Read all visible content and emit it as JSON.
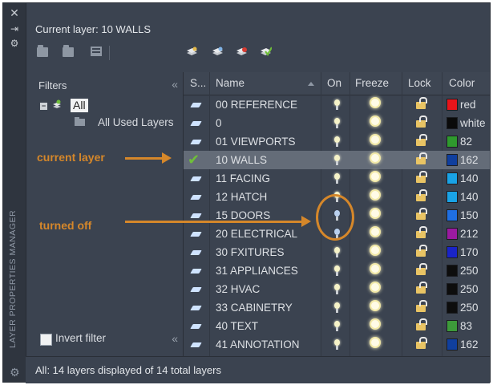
{
  "window": {
    "current_layer_text": "Current layer: 10 WALLS",
    "vertical_title": "LAYER PROPERTIES MANAGER",
    "status_text": "All: 14 layers displayed of 14 total layers"
  },
  "filters": {
    "title": "Filters",
    "tree_root": "All",
    "tree_child": "All Used Layers",
    "invert_label": "Invert filter",
    "collapse_symbol": "«"
  },
  "table": {
    "headers": {
      "status": "S...",
      "name": "Name",
      "on": "On",
      "freeze": "Freeze",
      "lock": "Lock",
      "color": "Color"
    },
    "rows": [
      {
        "name": "00 REFERENCE",
        "on": true,
        "color_name": "red",
        "color_hex": "#e8141b",
        "current": false
      },
      {
        "name": "0",
        "on": true,
        "color_name": "white",
        "color_hex": "#0a0a0a",
        "current": false
      },
      {
        "name": "01 VIEWPORTS",
        "on": true,
        "color_name": "82",
        "color_hex": "#2f9a2e",
        "current": false
      },
      {
        "name": "10 WALLS",
        "on": true,
        "color_name": "162",
        "color_hex": "#103f9e",
        "current": true
      },
      {
        "name": "11 FACING",
        "on": true,
        "color_name": "140",
        "color_hex": "#19a3e6",
        "current": false
      },
      {
        "name": "12 HATCH",
        "on": true,
        "color_name": "140",
        "color_hex": "#19a3e6",
        "current": false
      },
      {
        "name": "15 DOORS",
        "on": false,
        "color_name": "150",
        "color_hex": "#1f6fe3",
        "current": false
      },
      {
        "name": "20 ELECTRICAL",
        "on": false,
        "color_name": "212",
        "color_hex": "#9a1aa0",
        "current": false
      },
      {
        "name": "30 FXITURES",
        "on": true,
        "color_name": "170",
        "color_hex": "#1a24c8",
        "current": false
      },
      {
        "name": "31 APPLIANCES",
        "on": true,
        "color_name": "250",
        "color_hex": "#0d0d0d",
        "current": false
      },
      {
        "name": "32 HVAC",
        "on": true,
        "color_name": "250",
        "color_hex": "#0d0d0d",
        "current": false
      },
      {
        "name": "33 CABINETRY",
        "on": true,
        "color_name": "250",
        "color_hex": "#0d0d0d",
        "current": false
      },
      {
        "name": "40 TEXT",
        "on": true,
        "color_name": "83",
        "color_hex": "#3d9a3a",
        "current": false
      },
      {
        "name": "41 ANNOTATION",
        "on": true,
        "color_name": "162",
        "color_hex": "#103f9e",
        "current": false
      }
    ]
  },
  "annotations": {
    "current_layer": "current layer",
    "turned_off": "turned off",
    "color": "#d5872a"
  },
  "icons": {
    "close": "close-icon",
    "autohide": "autohide-icon",
    "settings": "gear-icon",
    "new_property_filter": "new-property-filter-icon",
    "new_group_filter": "new-group-filter-icon",
    "layer_states": "layer-states-manager-icon",
    "new_layer": "new-layer-icon",
    "new_layer_frozen": "new-layer-vp-frozen-icon",
    "delete_layer": "delete-layer-icon",
    "set_current": "set-current-icon"
  }
}
